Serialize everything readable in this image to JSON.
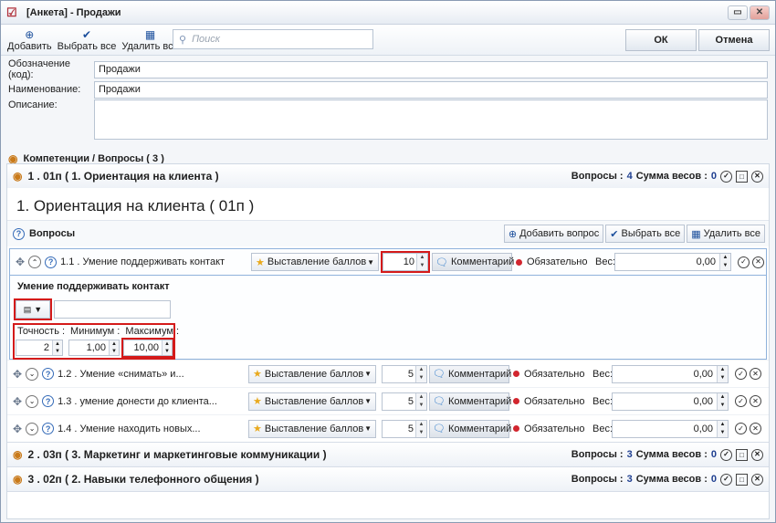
{
  "window": {
    "title": "[Анкета] - Продажи"
  },
  "toolbar": {
    "add_label": "Добавить",
    "select_all_label": "Выбрать все",
    "delete_all_label": "Удалить все",
    "search_placeholder": "Поиск",
    "ok_label": "ОК",
    "cancel_label": "Отмена"
  },
  "form": {
    "code_label": "Обозначение (код):",
    "code_value": "Продажи",
    "name_label": "Наименование:",
    "name_value": "Продажи",
    "desc_label": "Описание:",
    "desc_value": ""
  },
  "breadcrumb": "Компетенции  /  Вопросы ( 3 )",
  "groups": [
    {
      "title": "1 . 01п ( 1. Ориентация на клиента )",
      "questions_label": "Вопросы :",
      "questions_count": "4",
      "weights_label": "Сумма весов :",
      "weights_sum": "0"
    },
    {
      "title": "2 . 03п ( 3. Маркетинг и маркетинговые коммуникации  )",
      "questions_label": "Вопросы :",
      "questions_count": "3",
      "weights_label": "Сумма весов :",
      "weights_sum": "0"
    },
    {
      "title": "3 . 02п ( 2. Навыки телефонного общения )",
      "questions_label": "Вопросы :",
      "questions_count": "3",
      "weights_label": "Сумма весов :",
      "weights_sum": "0"
    }
  ],
  "group1": {
    "big_title": "1. Ориентация на клиента ( 01п )",
    "questions_header": "Вопросы",
    "add_question": "Добавить вопрос",
    "select_all": "Выбрать все",
    "delete_all": "Удалить все"
  },
  "questions": [
    {
      "text": "1.1 . Умение поддерживать контакт",
      "scoring": "Выставление баллов",
      "score": "10",
      "comment": "Комментарий",
      "mandatory": "Обязательно",
      "weight_label": "Вес:",
      "weight": "0,00"
    },
    {
      "text": "1.2 . Умение «снимать» и...",
      "scoring": "Выставление баллов",
      "score": "5",
      "comment": "Комментарий",
      "mandatory": "Обязательно",
      "weight_label": "Вес:",
      "weight": "0,00"
    },
    {
      "text": "1.3 . умение донести до клиента...",
      "scoring": "Выставление баллов",
      "score": "5",
      "comment": "Комментарий",
      "mandatory": "Обязательно",
      "weight_label": "Вес:",
      "weight": "0,00"
    },
    {
      "text": "1.4 . Умение находить новых...",
      "scoring": "Выставление баллов",
      "score": "5",
      "comment": "Комментарий",
      "mandatory": "Обязательно",
      "weight_label": "Вес:",
      "weight": "0,00"
    }
  ],
  "detail": {
    "title": "Умение поддерживать контакт",
    "precision_label": "Точность :",
    "precision": "2",
    "min_label": "Минимум :",
    "min": "1,00",
    "max_label": "Максимум :",
    "max": "10,00"
  },
  "icons": {
    "app": "form-icon",
    "add": "plus-circle-icon",
    "select": "check-circle-icon",
    "delete": "delete-grid-icon",
    "search": "search-icon",
    "move": "move-icon",
    "help": "help-icon",
    "star": "star-icon",
    "comment": "comment-icon"
  },
  "colors": {
    "highlight": "#d41a1a",
    "count": "#1f3f90",
    "mandatory_dot": "#d2262e"
  }
}
